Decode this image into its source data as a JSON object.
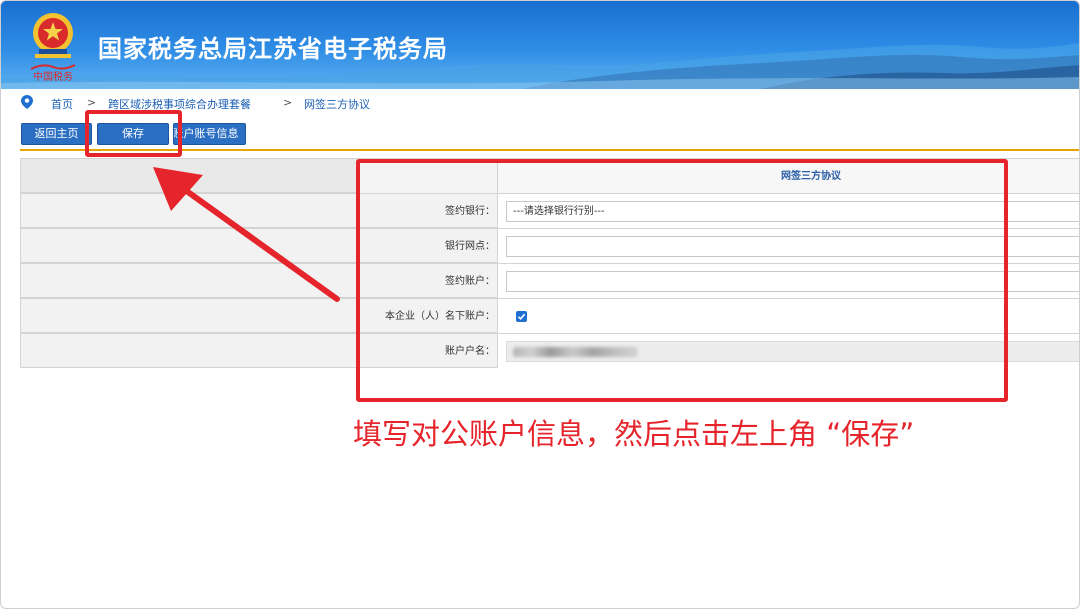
{
  "header": {
    "title": "国家税务总局江苏省电子税务局",
    "emblem_caption": "中国税务",
    "colors": {
      "banner_top": "#1a6fd0",
      "banner_bottom": "#5fb1f0"
    }
  },
  "breadcrumb": {
    "items": [
      "首页",
      "跨区域涉税事项综合办理套餐",
      "网签三方协议"
    ],
    "separator": ">"
  },
  "toolbar": {
    "back_label": "返回主页",
    "save_label": "保存",
    "account_info_label": "账户账号信息"
  },
  "form": {
    "title": "网签三方协议",
    "fields": [
      {
        "label": "签约银行：",
        "type": "select",
        "value": "---请选择银行行别---"
      },
      {
        "label": "银行网点：",
        "type": "input",
        "value": ""
      },
      {
        "label": "签约账户：",
        "type": "input",
        "value": ""
      },
      {
        "label": "本企业（人）名下账户：",
        "type": "checkbox",
        "checked": true
      },
      {
        "label": "账户户名：",
        "type": "readonly",
        "value": ""
      }
    ]
  },
  "annotation": {
    "text": "填写对公账户信息，然后点击左上角 “保存”",
    "color": "#e5242b"
  },
  "icons": {
    "location": "location-pin-icon",
    "emblem": "tax-emblem-icon",
    "checkmark": "checkmark-icon",
    "arrow": "red-arrow"
  }
}
